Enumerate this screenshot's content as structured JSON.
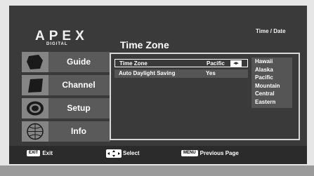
{
  "header": {
    "brand": "APEX",
    "brand_sub": "DIGITAL",
    "breadcrumb": "Time / Date"
  },
  "sidebar": {
    "items": [
      {
        "label": "Guide",
        "icon": "cube-icon"
      },
      {
        "label": "Channel",
        "icon": "panel-icon"
      },
      {
        "label": "Setup",
        "icon": "disc-icon"
      },
      {
        "label": "Info",
        "icon": "globe-icon"
      }
    ]
  },
  "panel": {
    "title": "Time Zone",
    "rows": [
      {
        "label": "Time Zone",
        "value": "Pacific"
      },
      {
        "label": "Auto Daylight Saving",
        "value": "Yes"
      }
    ]
  },
  "dropdown": {
    "options": [
      "Hawaii",
      "Alaska",
      "Pacific",
      "Mountain",
      "Central",
      "Eastern"
    ]
  },
  "footer": {
    "exit_key": "EXIT",
    "exit_label": "Exit",
    "select_label": "Select",
    "menu_key": "MENU",
    "menu_label": "Previous Page"
  },
  "colors": {
    "background": "#3a3a3a",
    "menu_item": "#5a5a5a",
    "text": "#ffffff"
  }
}
